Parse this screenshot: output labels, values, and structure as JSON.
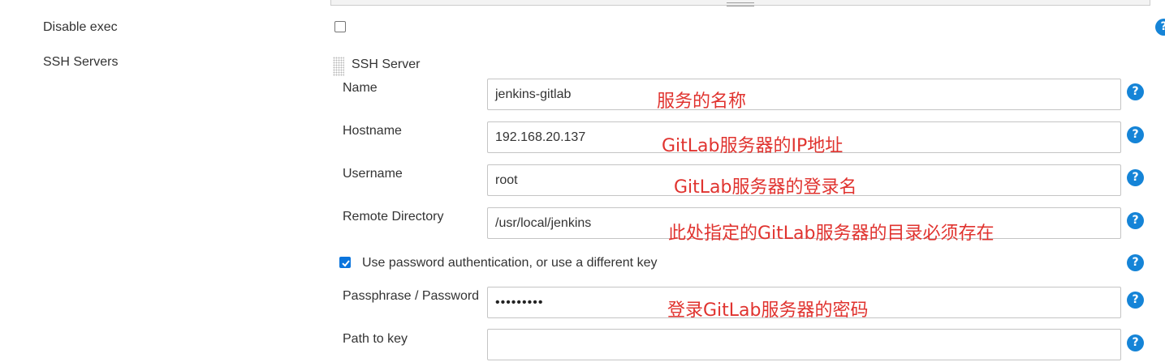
{
  "form": {
    "disable_exec": {
      "label": "Disable exec",
      "checked": false
    },
    "ssh_servers": {
      "label": "SSH Servers"
    }
  },
  "ssh_server": {
    "section_title": "SSH Server",
    "name": {
      "label": "Name",
      "value": "jenkins-gitlab",
      "annotation": "服务的名称"
    },
    "hostname": {
      "label": "Hostname",
      "value": "192.168.20.137",
      "annotation": "GitLab服务器的IP地址"
    },
    "username": {
      "label": "Username",
      "value": "root",
      "annotation": "GitLab服务器的登录名"
    },
    "remote_directory": {
      "label": "Remote Directory",
      "value": "/usr/local/jenkins",
      "annotation": "此处指定的GitLab服务器的目录必须存在"
    },
    "use_password": {
      "label": "Use password authentication, or use a different key",
      "checked": true
    },
    "passphrase": {
      "label": "Passphrase / Password",
      "value": "•••••••••",
      "annotation": "登录GitLab服务器的密码"
    },
    "path_to_key": {
      "label": "Path to key",
      "value": ""
    }
  },
  "help_icon_glyph": "?",
  "colors": {
    "accent": "#1584d7",
    "checkbox_checked": "#0b75dd",
    "annotation": "#e0332f",
    "field_border": "#c4c4c4"
  },
  "icons": [
    "help-icon",
    "checkmark-icon",
    "drag-handle-icon"
  ]
}
